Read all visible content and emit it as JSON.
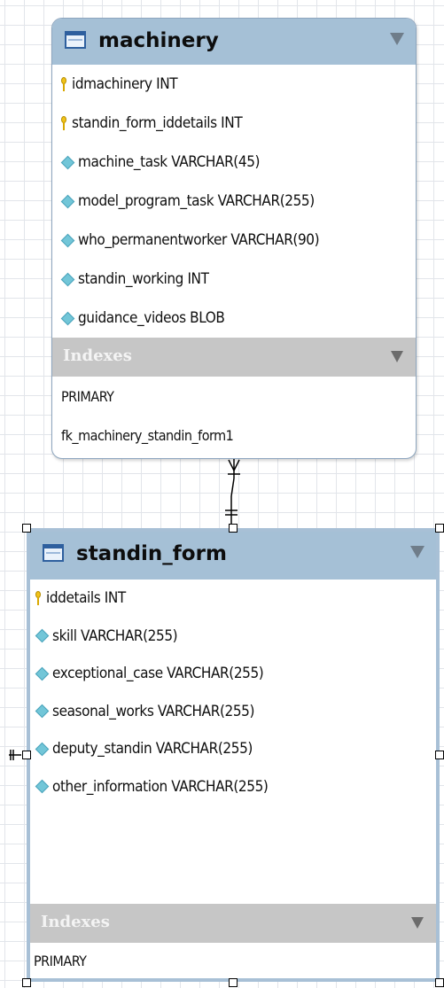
{
  "tables": [
    {
      "title": "machinery",
      "columns": [
        {
          "key": true,
          "text": "idmachinery INT"
        },
        {
          "key": true,
          "text": "standin_form_iddetails INT"
        },
        {
          "key": false,
          "text": "machine_task VARCHAR(45)"
        },
        {
          "key": false,
          "text": "model_program_task VARCHAR(255)"
        },
        {
          "key": false,
          "text": "who_permanentworker VARCHAR(90)"
        },
        {
          "key": false,
          "text": "standin_working INT"
        },
        {
          "key": false,
          "text": "guidance_videos BLOB"
        }
      ],
      "indexes_label": "Indexes",
      "indexes": [
        "PRIMARY",
        "fk_machinery_standin_form1"
      ]
    },
    {
      "title": "standin_form",
      "columns": [
        {
          "key": true,
          "text": "iddetails INT"
        },
        {
          "key": false,
          "text": "skill VARCHAR(255)"
        },
        {
          "key": false,
          "text": "exceptional_case VARCHAR(255)"
        },
        {
          "key": false,
          "text": "seasonal_works VARCHAR(255)"
        },
        {
          "key": false,
          "text": "deputy_standin VARCHAR(255)"
        },
        {
          "key": false,
          "text": "other_information VARCHAR(255)"
        }
      ],
      "indexes_label": "Indexes",
      "indexes": [
        "PRIMARY"
      ]
    }
  ],
  "icons": {
    "table": "table-icon",
    "primary_key": "key-icon",
    "column": "diamond-icon",
    "collapse": "collapse-arrow-icon"
  },
  "colors": {
    "header_bg": "#a5c0d6",
    "indexes_bg": "#c6c6c6",
    "key": "#f2c318",
    "column_diamond": "#72c6d8"
  }
}
